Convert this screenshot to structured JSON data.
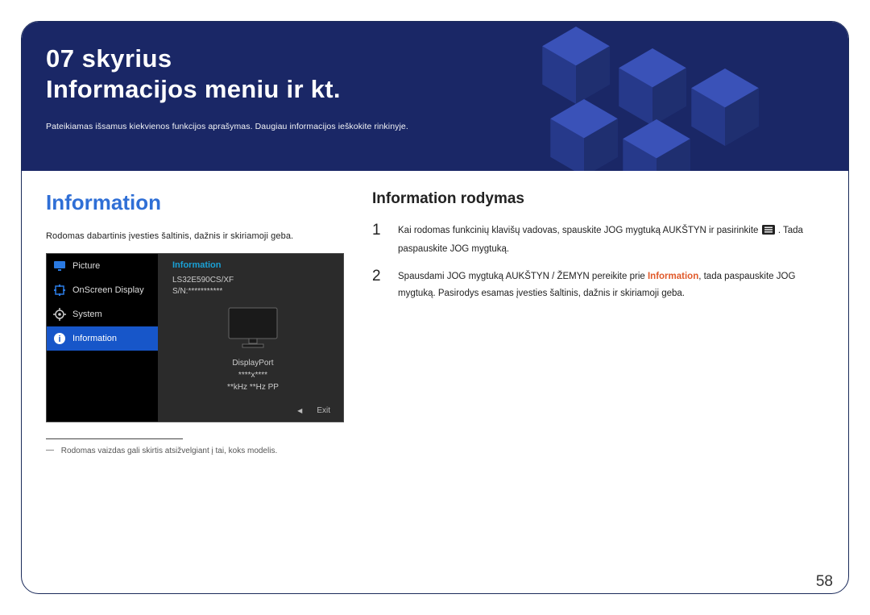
{
  "header": {
    "chapter": "07 skyrius",
    "title": "Informacijos meniu ir kt.",
    "subtitle": "Pateikiamas išsamus kiekvienos funkcijos aprašymas. Daugiau informacijos ieškokite rinkinyje."
  },
  "left": {
    "heading": "Information",
    "description": "Rodomas dabartinis įvesties šaltinis, dažnis ir skiriamoji geba.",
    "footnote": "Rodomas vaizdas gali skirtis atsižvelgiant į tai, koks modelis."
  },
  "osd": {
    "menu": [
      {
        "label": "Picture",
        "icon": "monitor-icon"
      },
      {
        "label": "OnScreen Display",
        "icon": "osd-icon"
      },
      {
        "label": "System",
        "icon": "gear-icon"
      },
      {
        "label": "Information",
        "icon": "info-icon"
      }
    ],
    "panel_title": "Information",
    "model": "LS32E590CS/XF",
    "serial": "S/N:***********",
    "port": "DisplayPort",
    "resolution": "****x****",
    "freq": "**kHz **Hz PP",
    "exit_label": "Exit"
  },
  "right": {
    "heading": "Information rodymas",
    "steps": [
      {
        "num": "1",
        "pre": "Kai rodomas funkcinių klavišų vadovas, spauskite JOG mygtuką AUKŠTYN ir pasirinkite ",
        "post": ". Tada paspauskite JOG mygtuką."
      },
      {
        "num": "2",
        "pre": "Spausdami JOG mygtuką AUKŠTYN / ŽEMYN pereikite prie ",
        "hl": "Information",
        "post": ", tada paspauskite JOG mygtuką. Pasirodys esamas įvesties šaltinis, dažnis ir skiriamoji geba."
      }
    ]
  },
  "page_number": "58"
}
